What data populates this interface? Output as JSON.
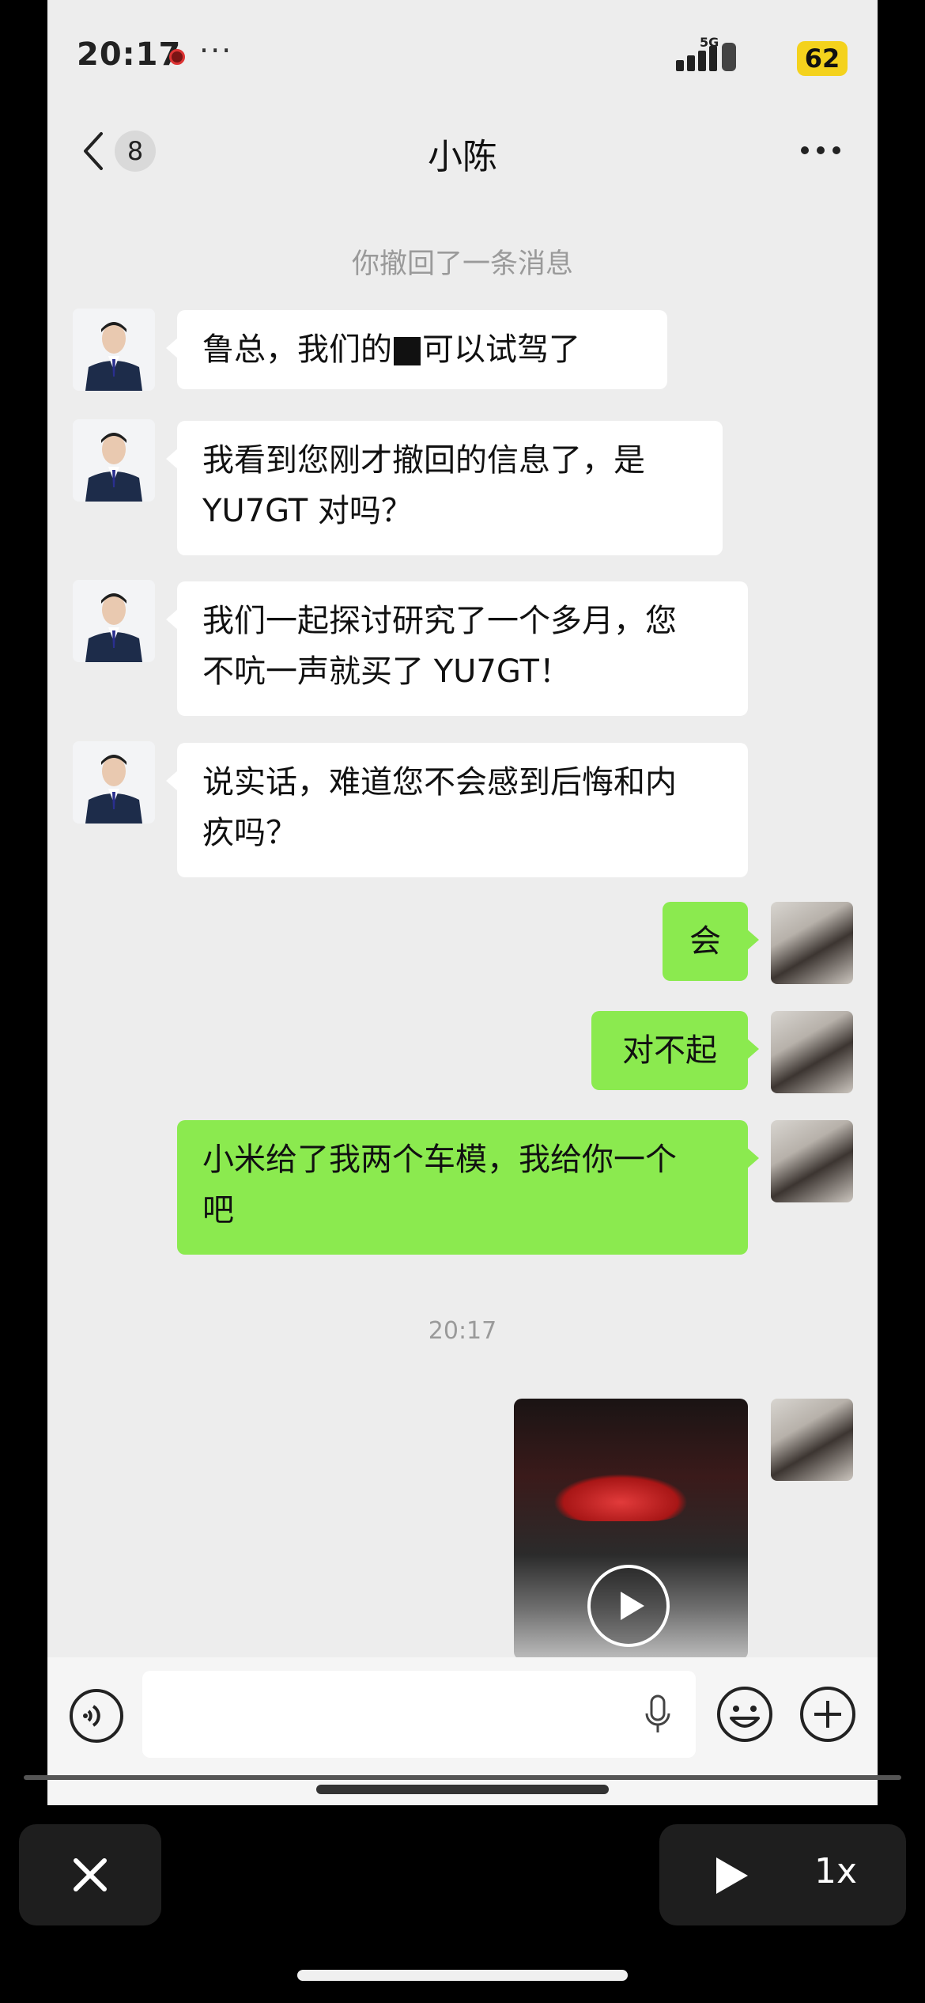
{
  "status_bar": {
    "time": "20:17",
    "battery": "62",
    "network": "5G",
    "more": "···"
  },
  "nav": {
    "back_count": "8",
    "title": "小陈"
  },
  "system_note": "你撤回了一条消息",
  "messages": [
    {
      "side": "in",
      "line1": "鲁总，我们的",
      "line1b": "可以试驾了"
    },
    {
      "side": "in",
      "line1": "我看到您刚才撤回的信息了，是",
      "line2": "YU7GT 对吗？"
    },
    {
      "side": "in",
      "line1": "我们一起探讨研究了一个多月，您",
      "line2": "不吭一声就买了 YU7GT！"
    },
    {
      "side": "in",
      "line1": "说实话，难道您不会感到后悔和内",
      "line2": "疚吗？"
    },
    {
      "side": "out",
      "text": "会"
    },
    {
      "side": "out",
      "text": "对不起"
    },
    {
      "side": "out",
      "line1": "小米给了我两个车模，我给你一个",
      "line2": "吧"
    }
  ],
  "time_divider": "20:17",
  "video_message": {
    "type": "video",
    "icon": "play-icon"
  },
  "player": {
    "speed": "1x"
  },
  "colors": {
    "bubble_out": "#8bea4f",
    "bubble_in": "#ffffff",
    "chat_bg": "#ededed",
    "battery": "#f4d21d"
  }
}
